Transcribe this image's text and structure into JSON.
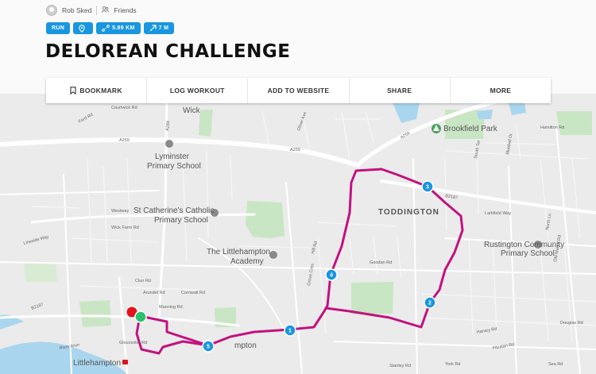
{
  "user": {
    "name": "Rob Sked",
    "visibility": "Friends"
  },
  "tags": {
    "activity": "RUN",
    "distance": "5.89 KM",
    "elevation": "7 M"
  },
  "title": "DELOREAN CHALLENGE",
  "toolbar": {
    "bookmark": "BOOKMARK",
    "log_workout": "LOG WORKOUT",
    "add_to_website": "ADD TO WEBSITE",
    "share": "SHARE",
    "more": "MORE"
  },
  "colors": {
    "route": "#c2127f",
    "tag": "#1996e0",
    "marker": "#1996e0",
    "start": "#e0141a",
    "finish": "#27c26a"
  },
  "map": {
    "places": {
      "wick": "Wick",
      "lyminster_school_1": "Lyminster",
      "lyminster_school_2": "Primary School",
      "st_catherine_1": "St Catherine's Catholic",
      "st_catherine_2": "Primary School",
      "littlehampton_academy_1": "The Littlehampton",
      "littlehampton_academy_2": "Academy",
      "brookfield_park": "Brookfield Park",
      "toddington": "TODDINGTON",
      "rustington_1": "Rustington Community",
      "rustington_2": "Primary School",
      "littlehampton": "Littlehampton",
      "river_arun": "River Arun",
      "lyminster_area": "mpton"
    },
    "roads": {
      "a259_1": "A259",
      "a259_2": "A259",
      "a259_3": "A259",
      "a284": "A284",
      "b2187_1": "B2187",
      "b2187_2": "B2187",
      "courtwick_rd": "Courtwick Rd",
      "westway": "Westway",
      "wick_farm_rd": "Wick Farm Rd",
      "cornwall_rd": "Cornwall Rd",
      "arundel_rd": "Arundel Rd",
      "clun_rd": "Clun Rd",
      "manning_rd": "Manning Rd",
      "gloucester_rd": "Gloucester Rd",
      "lineside_way": "Lineside Way",
      "hill_rd": "Hill Rd",
      "goodan_rd": "Goodan Rd",
      "hamilton_rd": "Hamilton Rd",
      "north_ln": "North Ln",
      "south_ter": "South Ter",
      "grove_cres": "Grove Cres",
      "bluebell_dr": "Bluebell Dr",
      "old_manor_rd": "Old Manor Rd",
      "douglas_rd": "Douglas Rd",
      "harvey_rd": "Harvey Rd",
      "fitzalan_rd": "Fitzalan Rd",
      "york_rd": "York Rd",
      "larkfield_way": "Larkfield Way",
      "oliver_ave": "Oliver Ave",
      "ford_rd": "Ford Rd",
      "stanley_rd": "Stanley Rd",
      "sea_rd": "Sea Rd"
    },
    "markers": [
      "1",
      "2",
      "3",
      "4",
      "5"
    ]
  }
}
